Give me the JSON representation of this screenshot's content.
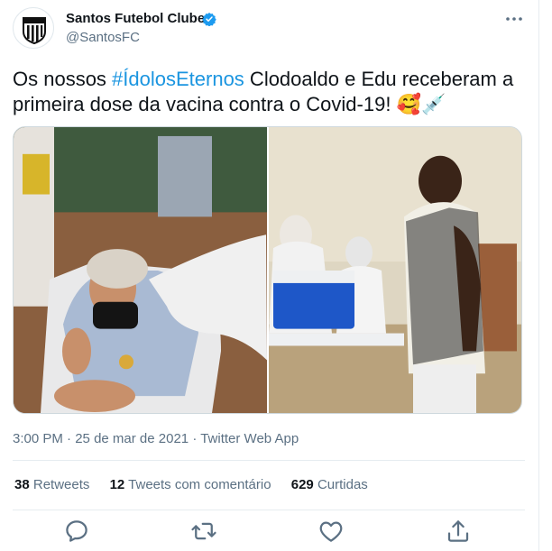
{
  "author": {
    "name": "Santos Futebol Clube",
    "handle": "@SantosFC"
  },
  "tweet": {
    "text_before": "Os nossos ",
    "hashtag": "#ÍdolosEternos",
    "text_after": " Clodoaldo e Edu receberam a primeira dose da vacina contra o Covid-19! 🥰💉",
    "time": "3:00 PM",
    "date": "25 de mar de 2021",
    "source": "Twitter Web App",
    "separator": " · "
  },
  "stats": {
    "retweets": {
      "count": "38",
      "label": "Retweets"
    },
    "quotes": {
      "count": "12",
      "label": "Tweets com comentário"
    },
    "likes": {
      "count": "629",
      "label": "Curtidas"
    }
  },
  "icons": {
    "verified": "verified-badge-icon",
    "more": "more-options-icon",
    "reply": "reply-icon",
    "retweet": "retweet-icon",
    "like": "heart-icon",
    "share": "share-icon"
  },
  "colors": {
    "accent": "#1d9bf0",
    "hashtag": "#1b95e0",
    "secondary_text": "#5b7083"
  }
}
